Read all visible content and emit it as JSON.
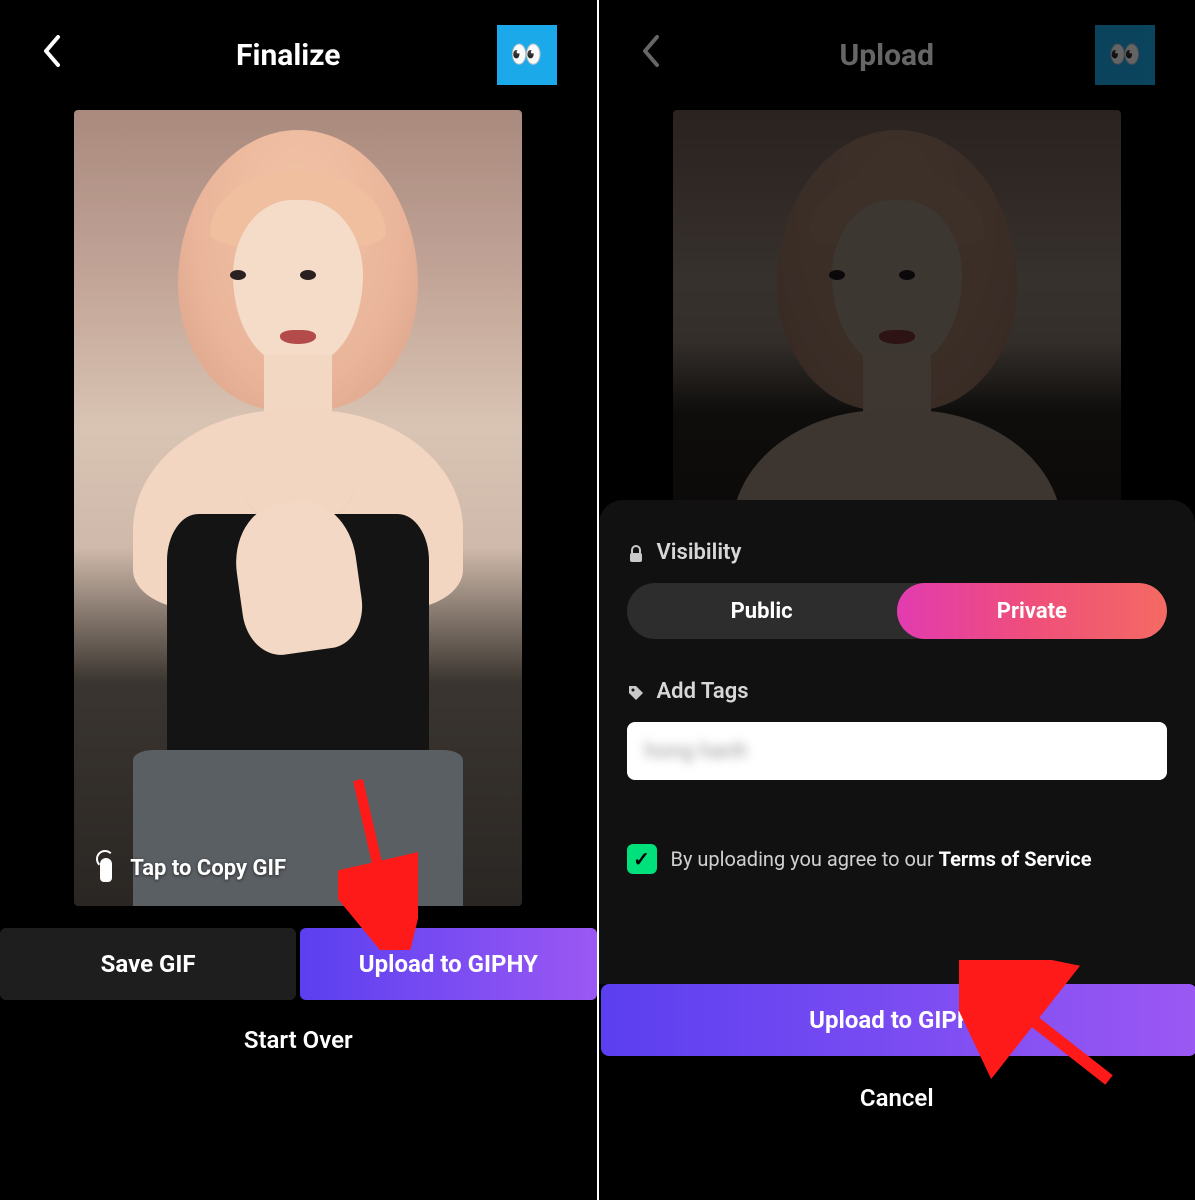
{
  "left": {
    "title": "Finalize",
    "avatar_emoji": "👀",
    "copy_label": "Tap to Copy GIF",
    "save_label": "Save GIF",
    "upload_label": "Upload to GIPHY",
    "start_over": "Start Over"
  },
  "right": {
    "title": "Upload",
    "avatar_emoji": "👀",
    "visibility_label": "Visibility",
    "visibility": {
      "public": "Public",
      "private": "Private",
      "selected": "Private"
    },
    "add_tags_label": "Add Tags",
    "tag_placeholder": "hong hanh",
    "agree_prefix": "By uploading you agree to our ",
    "tos": "Terms of Service",
    "upload_label": "Upload to GIPHY",
    "cancel_label": "Cancel",
    "checked": true
  },
  "annotations": {
    "arrows": [
      "points-to-upload-left",
      "points-to-upload-right"
    ]
  }
}
